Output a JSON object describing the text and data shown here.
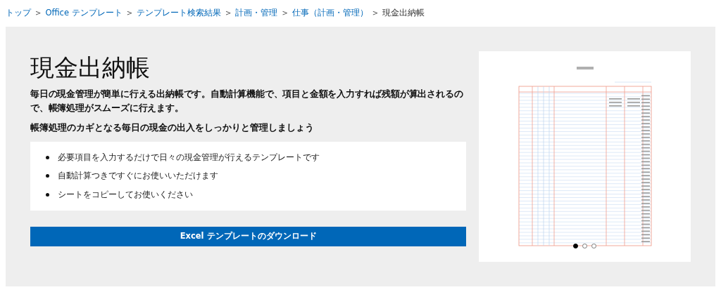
{
  "breadcrumb": [
    {
      "label": "トップ",
      "kind": "link"
    },
    {
      "label": "Office テンプレート",
      "kind": "link"
    },
    {
      "label": "テンプレート検索結果",
      "kind": "link"
    },
    {
      "label": "計画・管理",
      "kind": "link"
    },
    {
      "label": "仕事（計画・管理）",
      "kind": "link"
    },
    {
      "label": "現金出納帳",
      "kind": "current"
    }
  ],
  "separator": ">",
  "title": "現金出納帳",
  "description": "毎日の現金管理が簡単に行える出納帳です。自動計算機能で、項目と金額を入力すれば残額が算出されるので、帳簿処理がスムーズに行えます。",
  "subheading": "帳簿処理のカギとなる毎日の現金の出入をしっかりと管理しましょう",
  "features": [
    "必要項目を入力するだけで日々の現金管理が行えるテンプレートです",
    "自動計算つきですぐにお使いいただけます",
    "シートをコピーしてお使いください"
  ],
  "download_button": "Excel テンプレートのダウンロード",
  "carousel": [
    {
      "selected": true
    },
    {
      "selected": false
    },
    {
      "selected": false
    }
  ]
}
